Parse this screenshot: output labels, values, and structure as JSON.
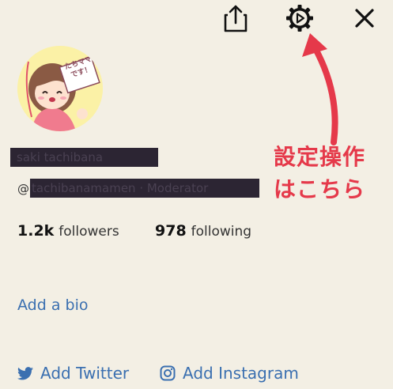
{
  "header": {
    "share_icon": "share-icon",
    "settings_icon": "gear-icon",
    "close_icon": "close-icon"
  },
  "profile": {
    "avatar_sign_text": "たちママです！",
    "display_name": "saki tachibana",
    "handle_prefix": "@",
    "handle": "tachibanamamen · Moderator"
  },
  "stats": {
    "followers_count": "1.2k",
    "followers_label": "followers",
    "following_count": "978",
    "following_label": "following"
  },
  "bio": {
    "add_bio_label": "Add a bio"
  },
  "social": {
    "twitter_label": "Add Twitter",
    "instagram_label": "Add Instagram"
  },
  "annotation": {
    "line1": "設定操作",
    "line2": "はこちら",
    "color": "#e5394a"
  },
  "colors": {
    "background": "#f3efe4",
    "link": "#3a6fb0",
    "redaction": "#2c2533"
  }
}
